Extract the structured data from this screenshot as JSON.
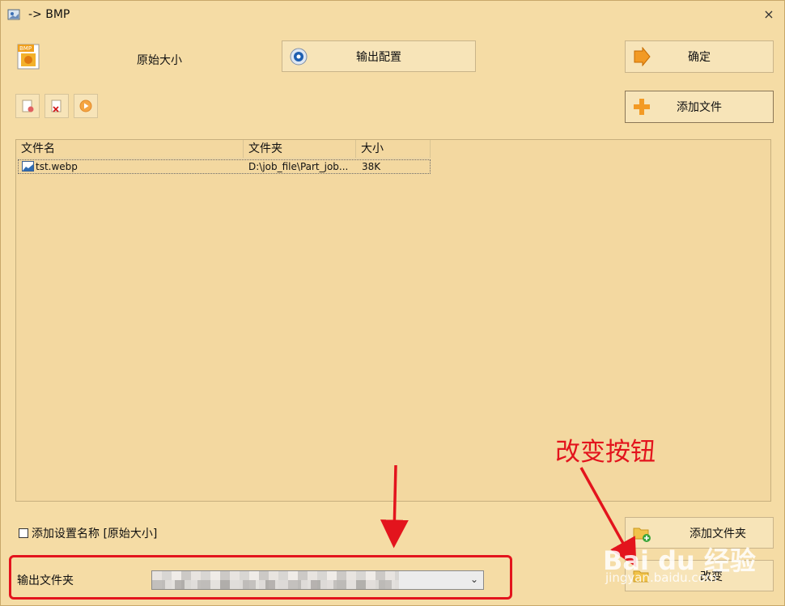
{
  "window": {
    "title": "-> BMP",
    "close_glyph": "×"
  },
  "toolbar": {
    "size_label": "原始大小",
    "output_config_label": "输出配置",
    "ok_label": "确定",
    "add_file_label": "添加文件"
  },
  "file_list": {
    "columns": [
      "文件名",
      "文件夹",
      "大小"
    ],
    "rows": [
      {
        "name": "tst.webp",
        "folder": "D:\\job_file\\Part_job...",
        "size": "38K"
      }
    ]
  },
  "options": {
    "add_setting_name_label": "添加设置名称 [原始大小]",
    "checked": false
  },
  "output": {
    "label": "输出文件夹",
    "add_folder_label": "添加文件夹",
    "change_label": "改变"
  },
  "annotation": {
    "text": "改变按钮",
    "color": "#e3141d"
  },
  "watermark": {
    "brand": "Bai du 经验",
    "url": "jingyan.baidu.com"
  },
  "colors": {
    "background": "#f5dca5",
    "accent": "#e3141d"
  }
}
